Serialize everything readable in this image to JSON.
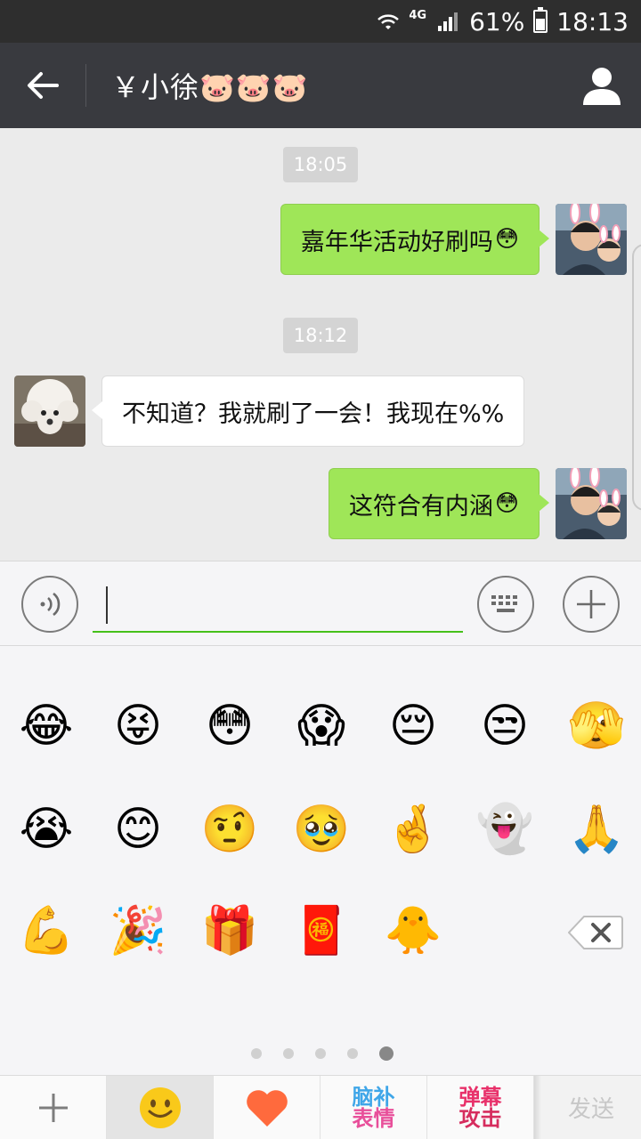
{
  "status_bar": {
    "network": "4G",
    "battery": "61%",
    "battery_level": 0.61,
    "time": "18:13"
  },
  "header": {
    "title": "￥小徐🐷🐷🐷",
    "back_icon": "arrow-left-icon",
    "contact_icon": "person-icon"
  },
  "messages": [
    {
      "kind": "time",
      "text": "18:05"
    },
    {
      "kind": "sent",
      "text": "嘉年华活动好刷吗",
      "emoji": "😳"
    },
    {
      "kind": "time",
      "text": "18:12"
    },
    {
      "kind": "received",
      "text": "不知道？我就刷了一会！我现在%%"
    },
    {
      "kind": "sent",
      "text": "这符合有内涵",
      "emoji": "😳"
    }
  ],
  "input": {
    "value": "",
    "voice_icon": "voice-icon",
    "keyboard_icon": "keyboard-icon",
    "more_icon": "plus-circle-icon"
  },
  "emoji_grid": [
    "😂",
    "😝",
    "😳",
    "😱",
    "😔",
    "😒",
    "🫣",
    "😭",
    "😊",
    "🤨",
    "🥹",
    "🤞",
    "👻",
    "🙏",
    "💪",
    "🎉",
    "🎁",
    "🧧",
    "🐥"
  ],
  "pager": {
    "pages": 5,
    "current": 5
  },
  "tabs": {
    "add_icon": "plus-icon",
    "emoji_icon": "smiley-icon",
    "favorite_icon": "heart-icon",
    "naobu_line1": "脑补",
    "naobu_line2": "表情",
    "danmu_line1": "弹幕",
    "danmu_line2": "攻击",
    "send_label": "发送"
  },
  "colors": {
    "accent_green": "#45c01a",
    "bubble_sent": "#9fe658",
    "header_bg": "#393a3f",
    "status_bg": "#2e2e2e"
  }
}
